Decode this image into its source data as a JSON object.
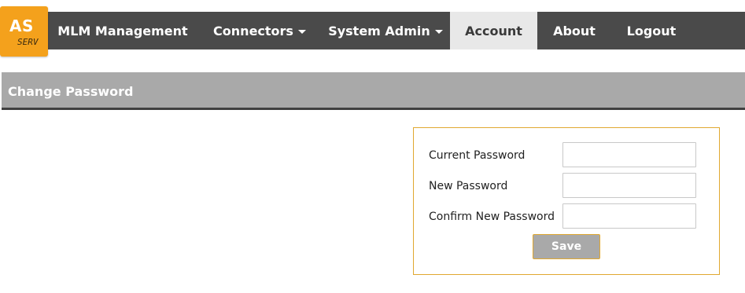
{
  "logo": {
    "main": "AS",
    "sub": "SERV"
  },
  "nav": {
    "items": [
      {
        "label": "MLM Management"
      },
      {
        "label": "Connectors"
      },
      {
        "label": "System Admin"
      },
      {
        "label": "Account"
      },
      {
        "label": "About"
      },
      {
        "label": "Logout"
      }
    ]
  },
  "section": {
    "title": "Change Password"
  },
  "form": {
    "current_password_label": "Current Password",
    "new_password_label": "New Password",
    "confirm_password_label": "Confirm New Password",
    "current_password_value": "",
    "new_password_value": "",
    "confirm_password_value": "",
    "save_label": "Save"
  },
  "colors": {
    "accent": "#f4a11c",
    "nav_bg": "#4a4a4a",
    "active_tab_bg": "#e8e8e8",
    "header_bg": "#a9a9a9",
    "panel_border": "#e0a830"
  }
}
